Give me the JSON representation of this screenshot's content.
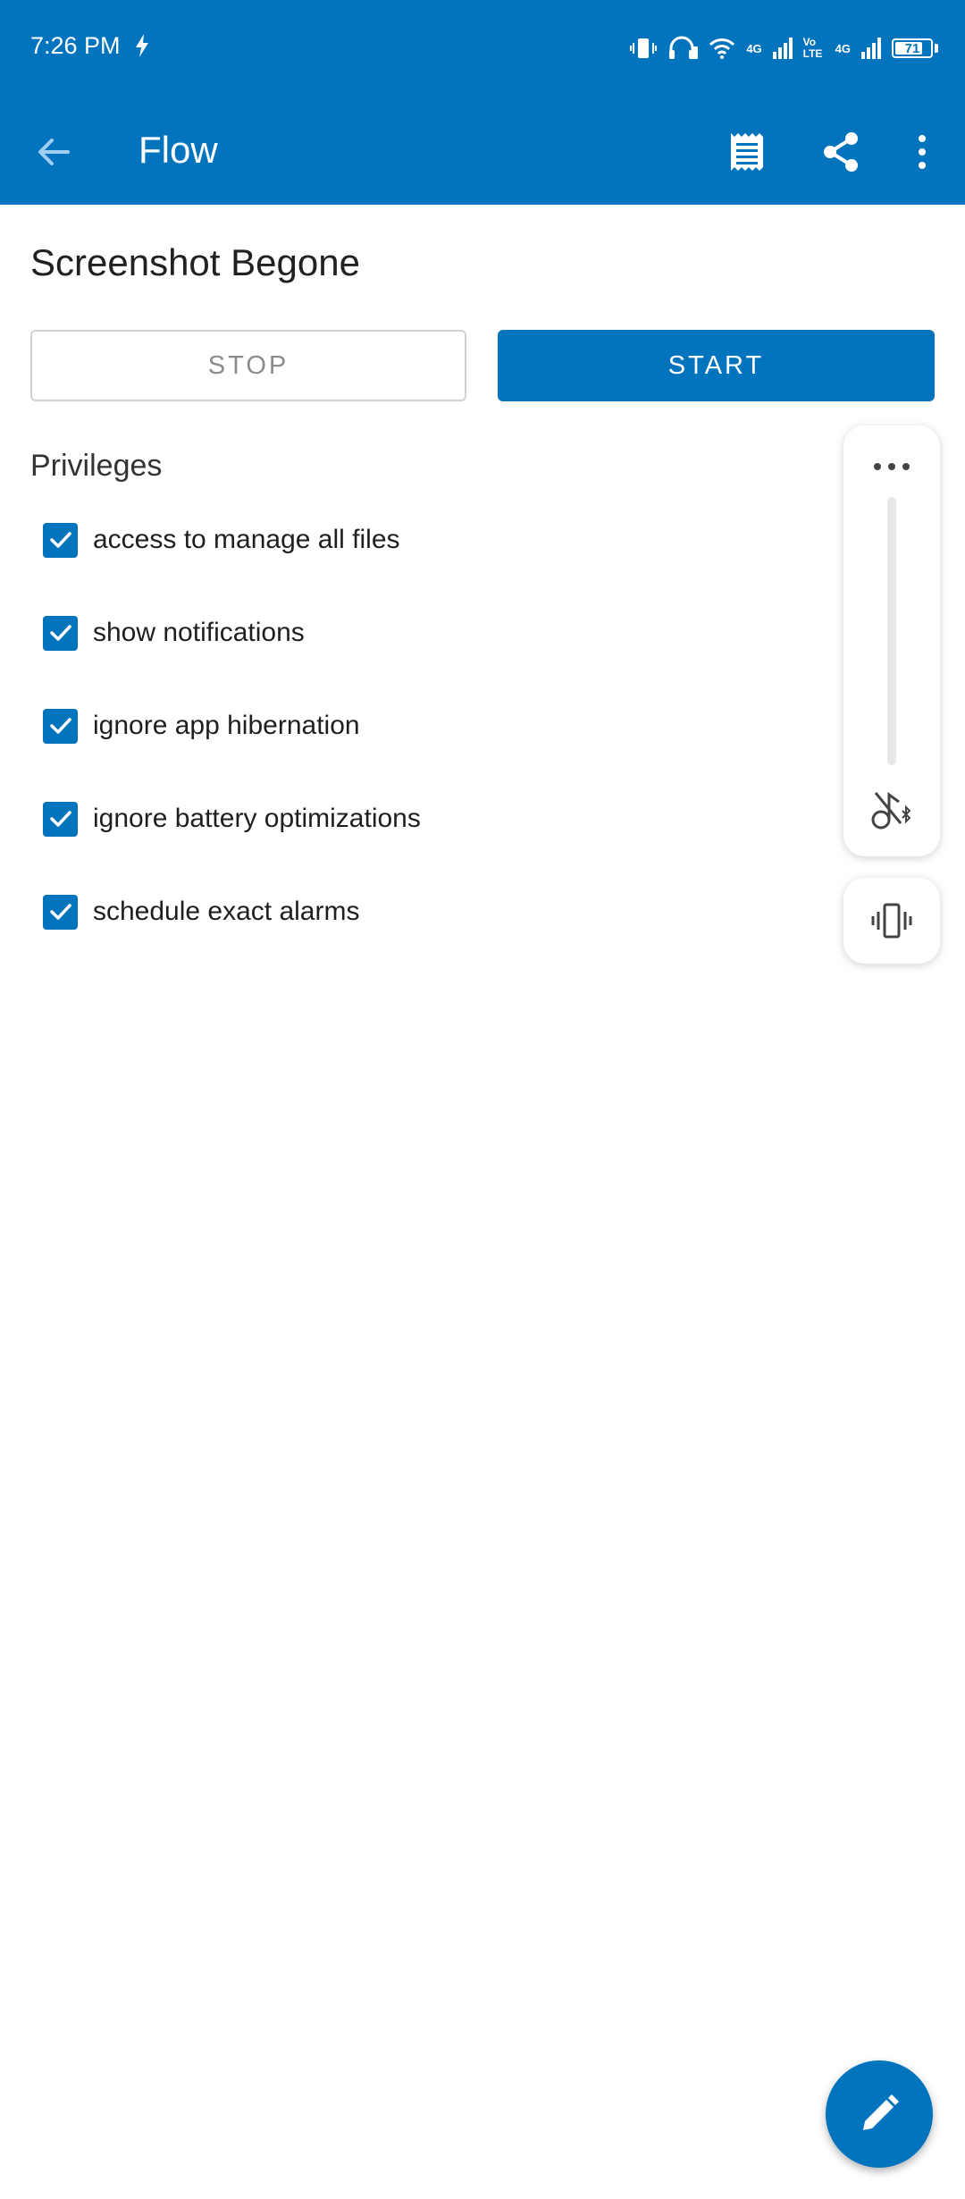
{
  "status_bar": {
    "time": "7:26 PM",
    "network_tag_1": "4G",
    "volte_tag": "Vo LTE",
    "network_tag_2": "4G",
    "battery_percent": "71"
  },
  "app_bar": {
    "title": "Flow",
    "icons": [
      "back-arrow-icon",
      "log-icon",
      "share-icon",
      "more-vert-icon"
    ]
  },
  "flow": {
    "name": "Screenshot Begone",
    "stop_label": "STOP",
    "start_label": "START"
  },
  "privileges": {
    "heading": "Privileges",
    "items": [
      {
        "label": "access to manage all files",
        "checked": true
      },
      {
        "label": "show notifications",
        "checked": true
      },
      {
        "label": "ignore app hibernation",
        "checked": true
      },
      {
        "label": "ignore battery optimizations",
        "checked": true
      },
      {
        "label": "schedule exact alarms",
        "checked": true
      }
    ]
  },
  "volume_panel": {
    "icons": [
      "more-horiz-icon",
      "bluetooth-music-off-icon",
      "vibrate-icon"
    ]
  },
  "fab": {
    "icon": "edit-pencil-icon"
  },
  "colors": {
    "primary": "#0273bd",
    "stop_border": "#d2d2d2",
    "stop_text": "#8c8c8c"
  }
}
